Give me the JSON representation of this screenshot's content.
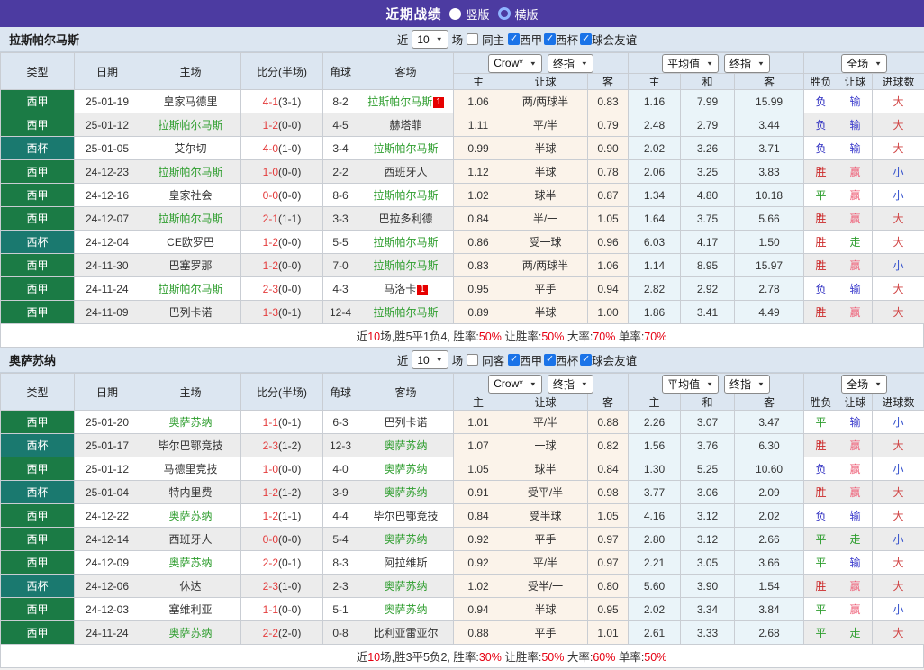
{
  "title_bar": {
    "title": "近期战绩",
    "radio_vertical_label": "竖版",
    "radio_horizontal_label": "横版",
    "selected": "竖版"
  },
  "colors": {
    "titlebar_bg": "#4c3ba1",
    "header_bg": "#dce6f1",
    "liga_green": "#1b7b45",
    "copa_teal": "#1a796f",
    "self_team_green": "#2f9e2f",
    "score_red": "#e43b3b",
    "badge_red": "#e60000",
    "odds_col_bg": "#fbf3ea",
    "avg_col_bg": "#eaf4f9",
    "alt_row_bg": "#ececec",
    "summary_red": "#e60012",
    "checkbox_blue": "#1a73e8"
  },
  "league_colors": {
    "西甲": "#1b7b45",
    "西杯": "#1a796f"
  },
  "result_colors": {
    "胜": "#cc2a2a",
    "平": "#2f9e2f",
    "负": "#2a2ac0",
    "赢": "#ee5f77",
    "输": "#3a3acc",
    "走": "#2f9e2f",
    "大": "#d04343",
    "小": "#3350cc"
  },
  "table_header": {
    "cols": [
      "类型",
      "日期",
      "主场",
      "比分(半场)",
      "角球",
      "客场"
    ],
    "sub": [
      "主",
      "让球",
      "客",
      "主",
      "和",
      "客",
      "胜负",
      "让球",
      "进球数"
    ]
  },
  "sections": [
    {
      "team": "拉斯帕尔马斯",
      "filter": {
        "near": "近",
        "games_value": "10",
        "games_unit": "场",
        "same_label": "同主",
        "same_checked": false,
        "leagues": [
          {
            "label": "西甲",
            "checked": true
          },
          {
            "label": "西杯",
            "checked": true
          },
          {
            "label": "球会友谊",
            "checked": true
          }
        ]
      },
      "selects": {
        "odds_primary": "Crow*",
        "odds_final": "终指",
        "avg_primary": "平均值",
        "avg_final": "终指",
        "scope": "全场"
      },
      "rows": [
        {
          "league": "西甲",
          "date": "25-01-19",
          "home": "皇家马德里",
          "home_self": false,
          "home_badge": "",
          "score": "4-1",
          "half": "(3-1)",
          "corner": "8-2",
          "away": "拉斯帕尔马斯",
          "away_self": true,
          "away_badge": "1",
          "odds": [
            "1.06",
            "两/两球半",
            "0.83"
          ],
          "avg": [
            "1.16",
            "7.99",
            "15.99"
          ],
          "results": [
            "负",
            "输",
            "大"
          ]
        },
        {
          "league": "西甲",
          "date": "25-01-12",
          "home": "拉斯帕尔马斯",
          "home_self": true,
          "home_badge": "",
          "score": "1-2",
          "half": "(0-0)",
          "corner": "4-5",
          "away": "赫塔菲",
          "away_self": false,
          "away_badge": "",
          "odds": [
            "1.11",
            "平/半",
            "0.79"
          ],
          "avg": [
            "2.48",
            "2.79",
            "3.44"
          ],
          "results": [
            "负",
            "输",
            "大"
          ]
        },
        {
          "league": "西杯",
          "date": "25-01-05",
          "home": "艾尔切",
          "home_self": false,
          "home_badge": "",
          "score": "4-0",
          "half": "(1-0)",
          "corner": "3-4",
          "away": "拉斯帕尔马斯",
          "away_self": true,
          "away_badge": "",
          "odds": [
            "0.99",
            "半球",
            "0.90"
          ],
          "avg": [
            "2.02",
            "3.26",
            "3.71"
          ],
          "results": [
            "负",
            "输",
            "大"
          ]
        },
        {
          "league": "西甲",
          "date": "24-12-23",
          "home": "拉斯帕尔马斯",
          "home_self": true,
          "home_badge": "",
          "score": "1-0",
          "half": "(0-0)",
          "corner": "2-2",
          "away": "西班牙人",
          "away_self": false,
          "away_badge": "",
          "odds": [
            "1.12",
            "半球",
            "0.78"
          ],
          "avg": [
            "2.06",
            "3.25",
            "3.83"
          ],
          "results": [
            "胜",
            "赢",
            "小"
          ]
        },
        {
          "league": "西甲",
          "date": "24-12-16",
          "home": "皇家社会",
          "home_self": false,
          "home_badge": "",
          "score": "0-0",
          "half": "(0-0)",
          "corner": "8-6",
          "away": "拉斯帕尔马斯",
          "away_self": true,
          "away_badge": "",
          "odds": [
            "1.02",
            "球半",
            "0.87"
          ],
          "avg": [
            "1.34",
            "4.80",
            "10.18"
          ],
          "results": [
            "平",
            "赢",
            "小"
          ]
        },
        {
          "league": "西甲",
          "date": "24-12-07",
          "home": "拉斯帕尔马斯",
          "home_self": true,
          "home_badge": "",
          "score": "2-1",
          "half": "(1-1)",
          "corner": "3-3",
          "away": "巴拉多利德",
          "away_self": false,
          "away_badge": "",
          "odds": [
            "0.84",
            "半/一",
            "1.05"
          ],
          "avg": [
            "1.64",
            "3.75",
            "5.66"
          ],
          "results": [
            "胜",
            "赢",
            "大"
          ]
        },
        {
          "league": "西杯",
          "date": "24-12-04",
          "home": "CE欧罗巴",
          "home_self": false,
          "home_badge": "",
          "score": "1-2",
          "half": "(0-0)",
          "corner": "5-5",
          "away": "拉斯帕尔马斯",
          "away_self": true,
          "away_badge": "",
          "odds": [
            "0.86",
            "受一球",
            "0.96"
          ],
          "avg": [
            "6.03",
            "4.17",
            "1.50"
          ],
          "results": [
            "胜",
            "走",
            "大"
          ]
        },
        {
          "league": "西甲",
          "date": "24-11-30",
          "home": "巴塞罗那",
          "home_self": false,
          "home_badge": "",
          "score": "1-2",
          "half": "(0-0)",
          "corner": "7-0",
          "away": "拉斯帕尔马斯",
          "away_self": true,
          "away_badge": "",
          "odds": [
            "0.83",
            "两/两球半",
            "1.06"
          ],
          "avg": [
            "1.14",
            "8.95",
            "15.97"
          ],
          "results": [
            "胜",
            "赢",
            "小"
          ]
        },
        {
          "league": "西甲",
          "date": "24-11-24",
          "home": "拉斯帕尔马斯",
          "home_self": true,
          "home_badge": "",
          "score": "2-3",
          "half": "(0-0)",
          "corner": "4-3",
          "away": "马洛卡",
          "away_self": false,
          "away_badge": "1",
          "odds": [
            "0.95",
            "平手",
            "0.94"
          ],
          "avg": [
            "2.82",
            "2.92",
            "2.78"
          ],
          "results": [
            "负",
            "输",
            "大"
          ]
        },
        {
          "league": "西甲",
          "date": "24-11-09",
          "home": "巴列卡诺",
          "home_self": false,
          "home_badge": "",
          "score": "1-3",
          "half": "(0-1)",
          "corner": "12-4",
          "away": "拉斯帕尔马斯",
          "away_self": true,
          "away_badge": "",
          "odds": [
            "0.89",
            "半球",
            "1.00"
          ],
          "avg": [
            "1.86",
            "3.41",
            "4.49"
          ],
          "results": [
            "胜",
            "赢",
            "大"
          ]
        }
      ],
      "summary": [
        {
          "text": "近",
          "red": false
        },
        {
          "text": "10",
          "red": true
        },
        {
          "text": "场,胜5平1负4, 胜率:",
          "red": false
        },
        {
          "text": "50%",
          "red": true
        },
        {
          "text": " 让胜率:",
          "red": false
        },
        {
          "text": "50%",
          "red": true
        },
        {
          "text": " 大率:",
          "red": false
        },
        {
          "text": "70%",
          "red": true
        },
        {
          "text": " 单率:",
          "red": false
        },
        {
          "text": "70%",
          "red": true
        }
      ]
    },
    {
      "team": "奥萨苏纳",
      "filter": {
        "near": "近",
        "games_value": "10",
        "games_unit": "场",
        "same_label": "同客",
        "same_checked": false,
        "leagues": [
          {
            "label": "西甲",
            "checked": true
          },
          {
            "label": "西杯",
            "checked": true
          },
          {
            "label": "球会友谊",
            "checked": true
          }
        ]
      },
      "selects": {
        "odds_primary": "Crow*",
        "odds_final": "终指",
        "avg_primary": "平均值",
        "avg_final": "终指",
        "scope": "全场"
      },
      "rows": [
        {
          "league": "西甲",
          "date": "25-01-20",
          "home": "奥萨苏纳",
          "home_self": true,
          "home_badge": "",
          "score": "1-1",
          "half": "(0-1)",
          "corner": "6-3",
          "away": "巴列卡诺",
          "away_self": false,
          "away_badge": "",
          "odds": [
            "1.01",
            "平/半",
            "0.88"
          ],
          "avg": [
            "2.26",
            "3.07",
            "3.47"
          ],
          "results": [
            "平",
            "输",
            "小"
          ]
        },
        {
          "league": "西杯",
          "date": "25-01-17",
          "home": "毕尔巴鄂竞技",
          "home_self": false,
          "home_badge": "",
          "score": "2-3",
          "half": "(1-2)",
          "corner": "12-3",
          "away": "奥萨苏纳",
          "away_self": true,
          "away_badge": "",
          "odds": [
            "1.07",
            "一球",
            "0.82"
          ],
          "avg": [
            "1.56",
            "3.76",
            "6.30"
          ],
          "results": [
            "胜",
            "赢",
            "大"
          ]
        },
        {
          "league": "西甲",
          "date": "25-01-12",
          "home": "马德里竞技",
          "home_self": false,
          "home_badge": "",
          "score": "1-0",
          "half": "(0-0)",
          "corner": "4-0",
          "away": "奥萨苏纳",
          "away_self": true,
          "away_badge": "",
          "odds": [
            "1.05",
            "球半",
            "0.84"
          ],
          "avg": [
            "1.30",
            "5.25",
            "10.60"
          ],
          "results": [
            "负",
            "赢",
            "小"
          ]
        },
        {
          "league": "西杯",
          "date": "25-01-04",
          "home": "特内里费",
          "home_self": false,
          "home_badge": "",
          "score": "1-2",
          "half": "(1-2)",
          "corner": "3-9",
          "away": "奥萨苏纳",
          "away_self": true,
          "away_badge": "",
          "odds": [
            "0.91",
            "受平/半",
            "0.98"
          ],
          "avg": [
            "3.77",
            "3.06",
            "2.09"
          ],
          "results": [
            "胜",
            "赢",
            "大"
          ]
        },
        {
          "league": "西甲",
          "date": "24-12-22",
          "home": "奥萨苏纳",
          "home_self": true,
          "home_badge": "",
          "score": "1-2",
          "half": "(1-1)",
          "corner": "4-4",
          "away": "毕尔巴鄂竞技",
          "away_self": false,
          "away_badge": "",
          "odds": [
            "0.84",
            "受半球",
            "1.05"
          ],
          "avg": [
            "4.16",
            "3.12",
            "2.02"
          ],
          "results": [
            "负",
            "输",
            "大"
          ]
        },
        {
          "league": "西甲",
          "date": "24-12-14",
          "home": "西班牙人",
          "home_self": false,
          "home_badge": "",
          "score": "0-0",
          "half": "(0-0)",
          "corner": "5-4",
          "away": "奥萨苏纳",
          "away_self": true,
          "away_badge": "",
          "odds": [
            "0.92",
            "平手",
            "0.97"
          ],
          "avg": [
            "2.80",
            "3.12",
            "2.66"
          ],
          "results": [
            "平",
            "走",
            "小"
          ]
        },
        {
          "league": "西甲",
          "date": "24-12-09",
          "home": "奥萨苏纳",
          "home_self": true,
          "home_badge": "",
          "score": "2-2",
          "half": "(0-1)",
          "corner": "8-3",
          "away": "阿拉维斯",
          "away_self": false,
          "away_badge": "",
          "odds": [
            "0.92",
            "平/半",
            "0.97"
          ],
          "avg": [
            "2.21",
            "3.05",
            "3.66"
          ],
          "results": [
            "平",
            "输",
            "大"
          ]
        },
        {
          "league": "西杯",
          "date": "24-12-06",
          "home": "休达",
          "home_self": false,
          "home_badge": "",
          "score": "2-3",
          "half": "(1-0)",
          "corner": "2-3",
          "away": "奥萨苏纳",
          "away_self": true,
          "away_badge": "",
          "odds": [
            "1.02",
            "受半/一",
            "0.80"
          ],
          "avg": [
            "5.60",
            "3.90",
            "1.54"
          ],
          "results": [
            "胜",
            "赢",
            "大"
          ]
        },
        {
          "league": "西甲",
          "date": "24-12-03",
          "home": "塞维利亚",
          "home_self": false,
          "home_badge": "",
          "score": "1-1",
          "half": "(0-0)",
          "corner": "5-1",
          "away": "奥萨苏纳",
          "away_self": true,
          "away_badge": "",
          "odds": [
            "0.94",
            "半球",
            "0.95"
          ],
          "avg": [
            "2.02",
            "3.34",
            "3.84"
          ],
          "results": [
            "平",
            "赢",
            "小"
          ]
        },
        {
          "league": "西甲",
          "date": "24-11-24",
          "home": "奥萨苏纳",
          "home_self": true,
          "home_badge": "",
          "score": "2-2",
          "half": "(2-0)",
          "corner": "0-8",
          "away": "比利亚雷亚尔",
          "away_self": false,
          "away_badge": "",
          "odds": [
            "0.88",
            "平手",
            "1.01"
          ],
          "avg": [
            "2.61",
            "3.33",
            "2.68"
          ],
          "results": [
            "平",
            "走",
            "大"
          ]
        }
      ],
      "summary": [
        {
          "text": "近",
          "red": false
        },
        {
          "text": "10",
          "red": true
        },
        {
          "text": "场,胜3平5负2, 胜率:",
          "red": false
        },
        {
          "text": "30%",
          "red": true
        },
        {
          "text": " 让胜率:",
          "red": false
        },
        {
          "text": "50%",
          "red": true
        },
        {
          "text": " 大率:",
          "red": false
        },
        {
          "text": "60%",
          "red": true
        },
        {
          "text": " 单率:",
          "red": false
        },
        {
          "text": "50%",
          "red": true
        }
      ]
    }
  ]
}
